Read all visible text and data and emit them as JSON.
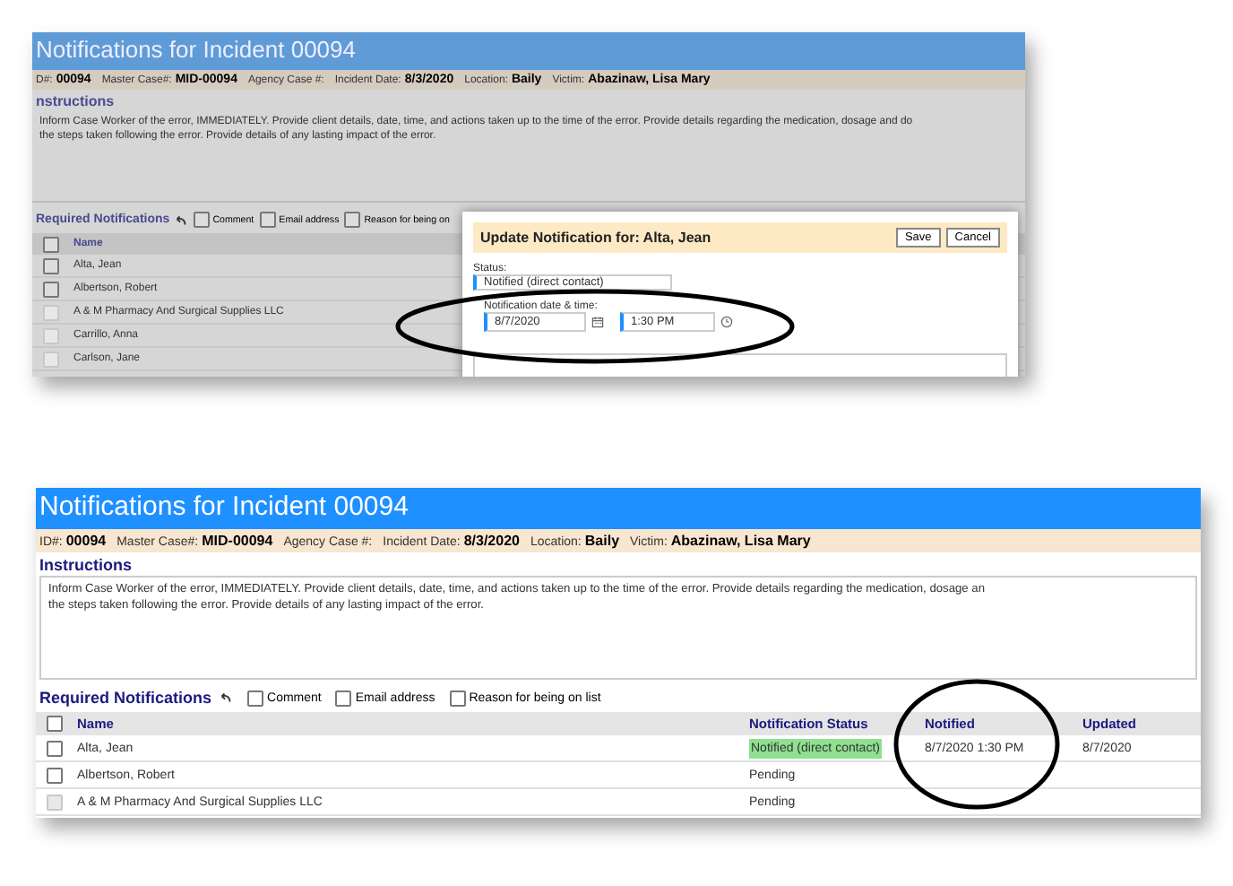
{
  "screenshots": [
    {
      "dimmed": true,
      "title": "Notifications for Incident 00094",
      "info": [
        {
          "label": "D#:",
          "value": "00094"
        },
        {
          "label": "Master Case#:",
          "value": "MID-00094"
        },
        {
          "label": "Agency Case #:"
        },
        {
          "label": "Incident Date:",
          "value": "8/3/2020"
        },
        {
          "label": "Location:",
          "value": "Baily"
        },
        {
          "label": "Victim:",
          "value": "Abazinaw, Lisa Mary"
        }
      ],
      "instructions_heading": "nstructions",
      "instructions": [
        "Inform Case Worker of the error, IMMEDIATELY.  Provide client details, date, time, and actions taken up to the time of the error.  Provide details regarding the medication, dosage and do",
        "the steps taken following the error.  Provide details of any lasting impact of the error."
      ],
      "section_title": "Required Notifications",
      "options": [
        "Comment",
        "Email address",
        "Reason for being on"
      ],
      "columns": [
        "Name"
      ],
      "rows": [
        {
          "disabled": false,
          "name": "Alta, Jean"
        },
        {
          "disabled": false,
          "name": "Albertson, Robert"
        },
        {
          "disabled": true,
          "name": "A & M Pharmacy And Surgical Supplies LLC"
        },
        {
          "disabled": true,
          "name": "Carrillo, Anna"
        },
        {
          "disabled": true,
          "name": "Carlson, Jane"
        }
      ],
      "dialog": {
        "title": "Update Notification for: Alta, Jean",
        "buttons": [
          "Save",
          "Cancel"
        ],
        "status_label": "Status:",
        "status_value": "Notified (direct contact)",
        "datetime_label": "Notification date & time:",
        "date": "8/7/2020",
        "time": "1:30 PM"
      }
    },
    {
      "dimmed": false,
      "title": "Notifications for Incident 00094",
      "info": [
        {
          "label": "ID#:",
          "value": "00094"
        },
        {
          "label": "Master Case#:",
          "value": "MID-00094"
        },
        {
          "label": "Agency Case #:"
        },
        {
          "label": "Incident Date:",
          "value": "8/3/2020"
        },
        {
          "label": "Location:",
          "value": "Baily"
        },
        {
          "label": "Victim:",
          "value": "Abazinaw, Lisa Mary"
        }
      ],
      "instructions_heading": "Instructions",
      "instructions": [
        "Inform Case Worker of the error, IMMEDIATELY.  Provide client details, date, time, and actions taken up to the time of the error.  Provide details regarding the medication, dosage an",
        "the steps taken following the error.  Provide details of any lasting impact of the error."
      ],
      "section_title": "Required Notifications",
      "options": [
        "Comment",
        "Email address",
        "Reason for being on list"
      ],
      "columns": [
        "Name",
        "Notification Status",
        "Notified",
        "Updated"
      ],
      "rows": [
        {
          "disabled": false,
          "name": "Alta, Jean",
          "status": {
            "text": "Notified (direct contact)",
            "highlighted": true
          },
          "notified": "8/7/2020 1:30 PM",
          "updated": "8/7/2020"
        },
        {
          "disabled": false,
          "name": "Albertson, Robert",
          "status": {
            "text": "Pending",
            "highlighted": false
          }
        },
        {
          "disabled": true,
          "name": "A & M Pharmacy And Surgical Supplies LLC",
          "status": {
            "text": "Pending",
            "highlighted": false
          }
        }
      ]
    }
  ]
}
